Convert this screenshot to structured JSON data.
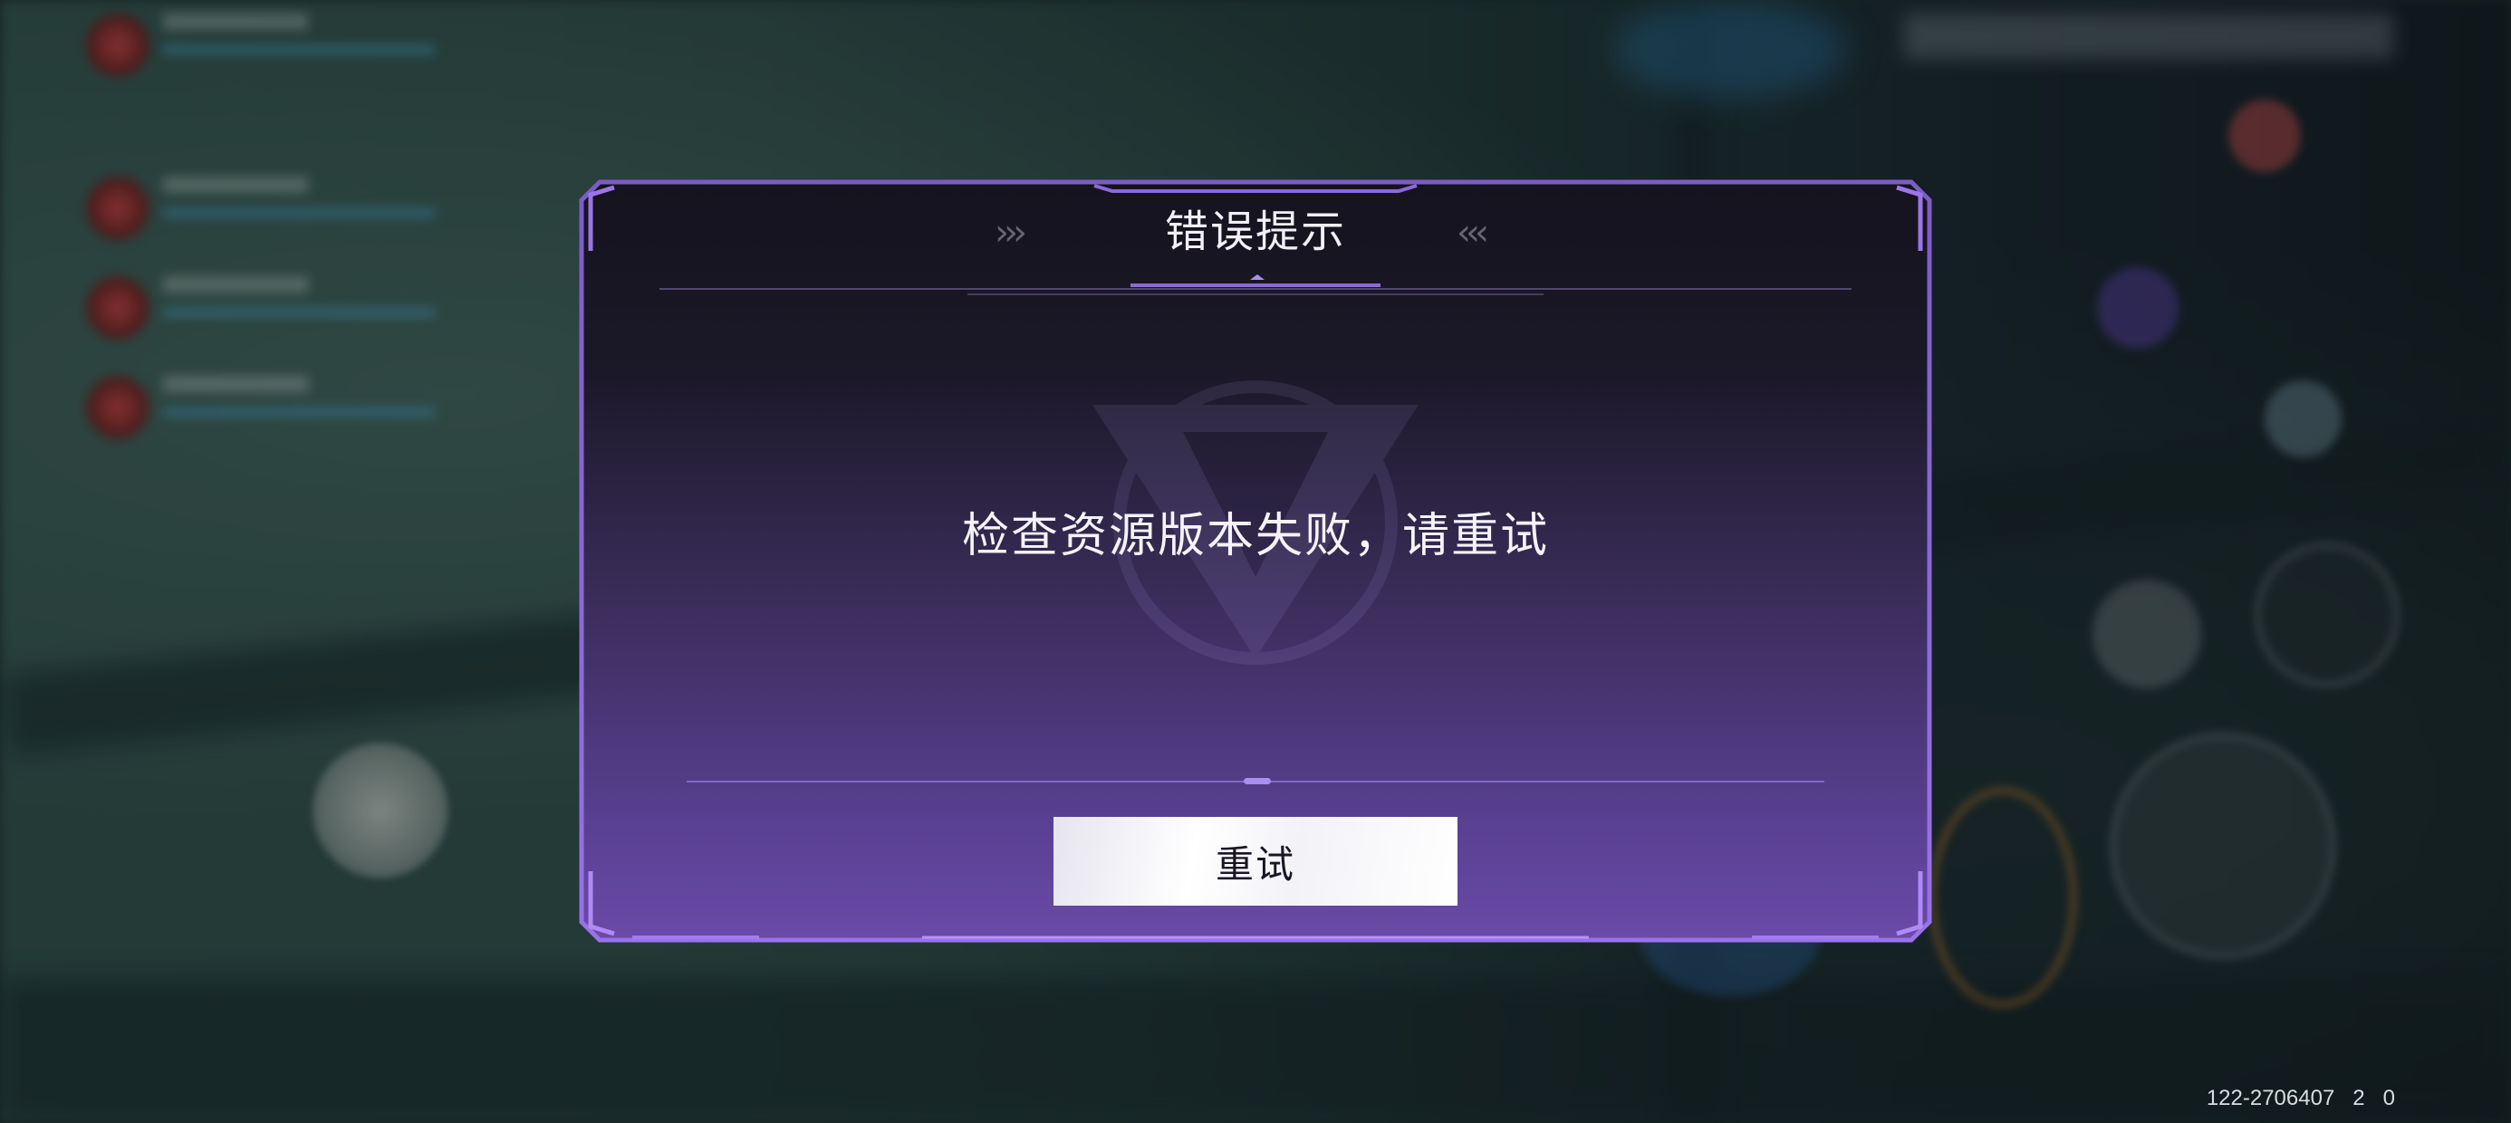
{
  "dialog": {
    "title": "错误提示",
    "chevrons_left": "›››",
    "chevrons_right": "‹‹‹",
    "message": "检查资源版本失败，请重试",
    "retry_label": "重试"
  },
  "debug": {
    "text": "122-2706407   2   0"
  },
  "colors": {
    "dialog_border": "#8a62d6",
    "dialog_top": "#15131e",
    "dialog_bottom": "#6a4aa8",
    "button_bg": "#ffffff",
    "title_text": "#f2f0f6"
  },
  "icons": {
    "left_chevrons": "triple-chevron-right-icon",
    "right_chevrons": "triple-chevron-left-icon",
    "emblem": "game-logo-emblem"
  }
}
